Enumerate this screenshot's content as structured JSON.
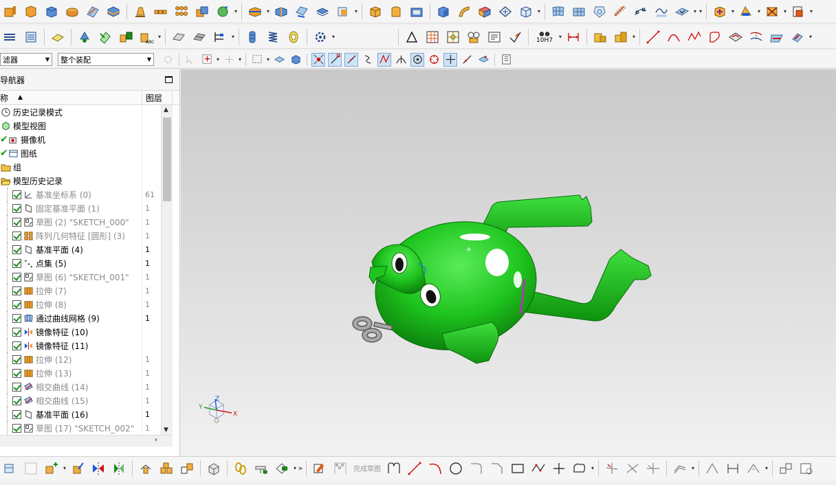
{
  "selection_bar": {
    "filter_label": "滤器",
    "assembly_scope": "整个装配"
  },
  "navigator": {
    "title": "导航器",
    "col_name": "称",
    "col_layer": "图层",
    "items": [
      {
        "label": "历史记录模式",
        "icon": "clock-icon",
        "layer": ""
      },
      {
        "label": "模型视图",
        "icon": "model-views-icon",
        "layer": ""
      },
      {
        "label": "摄像机",
        "icon": "camera-icon",
        "layer": ""
      },
      {
        "label": "图纸",
        "icon": "drawing-icon",
        "layer": ""
      },
      {
        "label": "组",
        "icon": "folder-icon",
        "layer": ""
      },
      {
        "label": "模型历史记录",
        "icon": "folder-open-icon",
        "layer": ""
      },
      {
        "label": "基准坐标系 (0)",
        "icon": "datum-csys-icon",
        "layer": "61"
      },
      {
        "label": "固定基准平面 (1)",
        "icon": "datum-plane-icon",
        "layer": "1"
      },
      {
        "label": "草图 (2) \"SKETCH_000\"",
        "icon": "sketch-icon",
        "layer": "1"
      },
      {
        "label": "阵列几何特征 [圆形] (3)",
        "icon": "pattern-icon",
        "layer": "1"
      },
      {
        "label": "基准平面 (4)",
        "icon": "datum-plane-icon",
        "layer": "1"
      },
      {
        "label": "点集 (5)",
        "icon": "point-set-icon",
        "layer": "1"
      },
      {
        "label": "草图 (6) \"SKETCH_001\"",
        "icon": "sketch-icon",
        "layer": "1"
      },
      {
        "label": "拉伸 (7)",
        "icon": "extrude-icon",
        "layer": "1"
      },
      {
        "label": "拉伸 (8)",
        "icon": "extrude-icon",
        "layer": "1"
      },
      {
        "label": "通过曲线网格 (9)",
        "icon": "curve-mesh-icon",
        "layer": "1"
      },
      {
        "label": "镜像特征 (10)",
        "icon": "mirror-icon",
        "layer": ""
      },
      {
        "label": "镜像特征 (11)",
        "icon": "mirror-icon",
        "layer": ""
      },
      {
        "label": "拉伸 (12)",
        "icon": "extrude-icon",
        "layer": "1"
      },
      {
        "label": "拉伸 (13)",
        "icon": "extrude-icon",
        "layer": "1"
      },
      {
        "label": "相交曲线 (14)",
        "icon": "intersect-curve-icon",
        "layer": "1"
      },
      {
        "label": "相交曲线 (15)",
        "icon": "intersect-curve-icon",
        "layer": "1"
      },
      {
        "label": "基准平面 (16)",
        "icon": "datum-plane-icon",
        "layer": "1"
      },
      {
        "label": "草图 (17) \"SKETCH_002\"",
        "icon": "sketch-icon",
        "layer": "1"
      }
    ]
  },
  "toolbar": {
    "tolerance_label": "10H7",
    "finish_sketch": "完成草图"
  },
  "triad": {
    "x": "X",
    "y": "Y",
    "z": "Z"
  },
  "colors": {
    "frog_green": "#1ec41e",
    "frog_dark": "#0e8a0e",
    "viewport_top": "#c9c9c9",
    "check_green": "#1a9a1a"
  }
}
